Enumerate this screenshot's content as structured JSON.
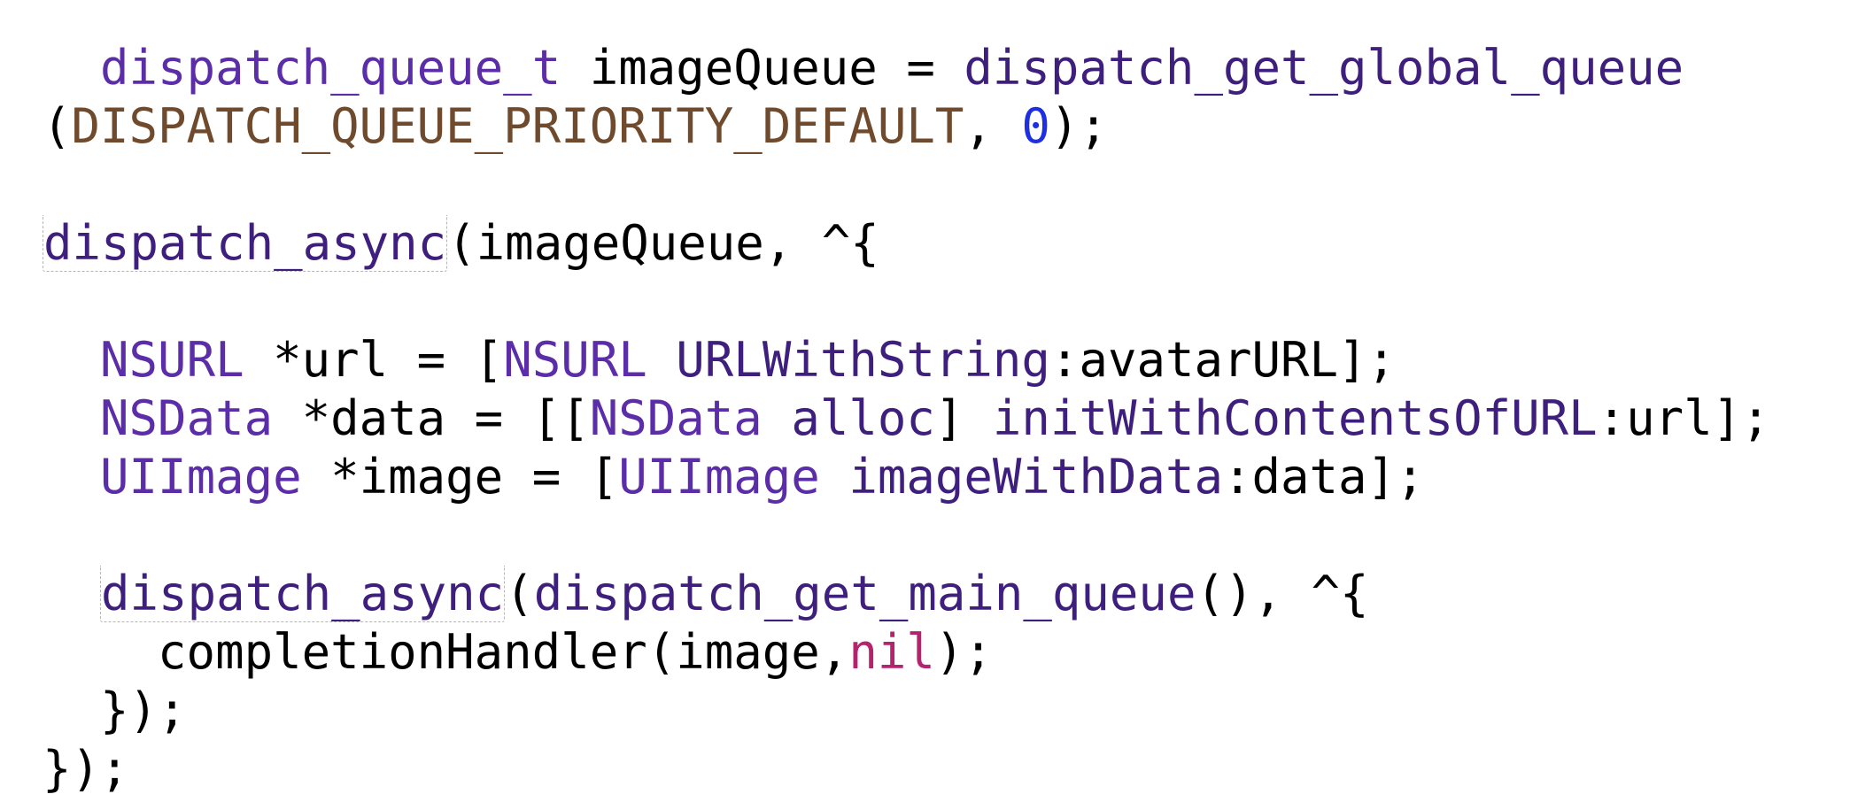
{
  "colors": {
    "background": "#ffffff",
    "plain": "#000000",
    "type": "#5b2da8",
    "function": "#3f1f7d",
    "macro": "#6f4a2c",
    "number": "#1d2fe0",
    "keyword": "#b5226e"
  },
  "code": {
    "lines": [
      {
        "tokens": [
          {
            "t": "  ",
            "k": "plain"
          },
          {
            "t": "dispatch_queue_t",
            "k": "type"
          },
          {
            "t": " imageQueue = ",
            "k": "plain"
          },
          {
            "t": "dispatch_get_global_queue",
            "k": "function"
          }
        ]
      },
      {
        "tokens": [
          {
            "t": "(",
            "k": "plain"
          },
          {
            "t": "DISPATCH_QUEUE_PRIORITY_DEFAULT",
            "k": "macro"
          },
          {
            "t": ", ",
            "k": "plain"
          },
          {
            "t": "0",
            "k": "number"
          },
          {
            "t": ");",
            "k": "plain"
          }
        ]
      },
      {
        "tokens": []
      },
      {
        "tokens": [
          {
            "t": "dispatch_async",
            "k": "function",
            "box": true
          },
          {
            "t": "(imageQueue, ^{",
            "k": "plain"
          }
        ]
      },
      {
        "tokens": []
      },
      {
        "tokens": [
          {
            "t": "  ",
            "k": "plain"
          },
          {
            "t": "NSURL",
            "k": "type"
          },
          {
            "t": " *url = [",
            "k": "plain"
          },
          {
            "t": "NSURL",
            "k": "type"
          },
          {
            "t": " ",
            "k": "plain"
          },
          {
            "t": "URLWithString",
            "k": "function"
          },
          {
            "t": ":avatarURL];",
            "k": "plain"
          }
        ]
      },
      {
        "tokens": [
          {
            "t": "  ",
            "k": "plain"
          },
          {
            "t": "NSData",
            "k": "type"
          },
          {
            "t": " *data = [[",
            "k": "plain"
          },
          {
            "t": "NSData",
            "k": "type"
          },
          {
            "t": " ",
            "k": "plain"
          },
          {
            "t": "alloc",
            "k": "function"
          },
          {
            "t": "] ",
            "k": "plain"
          },
          {
            "t": "initWithContentsOfURL",
            "k": "function"
          },
          {
            "t": ":url];",
            "k": "plain"
          }
        ]
      },
      {
        "tokens": [
          {
            "t": "  ",
            "k": "plain"
          },
          {
            "t": "UIImage",
            "k": "type"
          },
          {
            "t": " *image = [",
            "k": "plain"
          },
          {
            "t": "UIImage",
            "k": "type"
          },
          {
            "t": " ",
            "k": "plain"
          },
          {
            "t": "imageWithData",
            "k": "function"
          },
          {
            "t": ":data];",
            "k": "plain"
          }
        ]
      },
      {
        "tokens": []
      },
      {
        "tokens": [
          {
            "t": "  ",
            "k": "plain"
          },
          {
            "t": "dispatch_async",
            "k": "function",
            "box": true
          },
          {
            "t": "(",
            "k": "plain"
          },
          {
            "t": "dispatch_get_main_queue",
            "k": "function"
          },
          {
            "t": "(), ^{",
            "k": "plain"
          }
        ]
      },
      {
        "tokens": [
          {
            "t": "    completionHandler(image,",
            "k": "plain"
          },
          {
            "t": "nil",
            "k": "keyword"
          },
          {
            "t": ");",
            "k": "plain"
          }
        ]
      },
      {
        "tokens": [
          {
            "t": "  });",
            "k": "plain"
          }
        ]
      },
      {
        "tokens": [
          {
            "t": "});",
            "k": "plain"
          }
        ]
      }
    ]
  }
}
